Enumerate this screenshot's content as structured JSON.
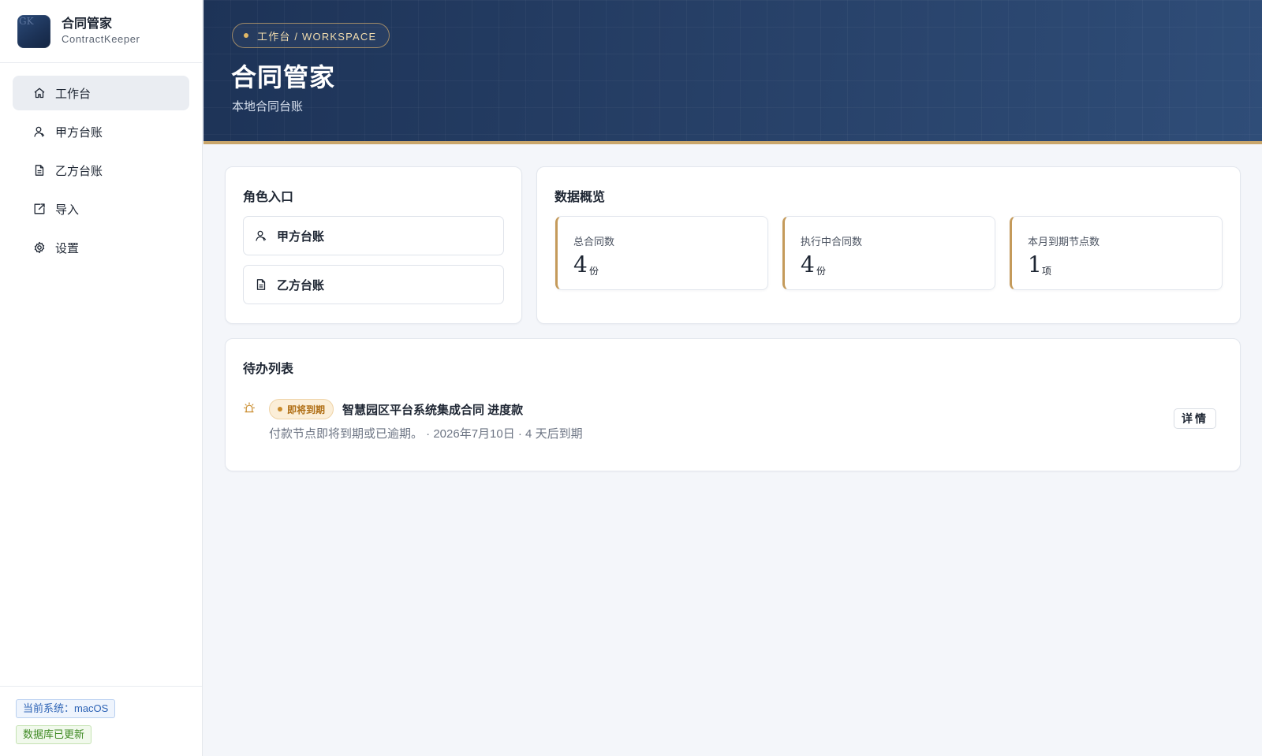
{
  "app": {
    "logo_text": "GK",
    "title": "合同管家",
    "subtitle": "ContractKeeper"
  },
  "nav": {
    "items": [
      {
        "label": "工作台",
        "icon": "home-icon",
        "active": true
      },
      {
        "label": "甲方台账",
        "icon": "user-icon"
      },
      {
        "label": "乙方台账",
        "icon": "document-icon"
      },
      {
        "label": "导入",
        "icon": "import-icon"
      },
      {
        "label": "设置",
        "icon": "gear-icon"
      }
    ]
  },
  "footer": {
    "system_tag": "当前系统：macOS",
    "db_tag": "数据库已更新"
  },
  "header": {
    "breadcrumb": "工作台 / WORKSPACE",
    "title": "合同管家",
    "subtitle": "本地合同台账"
  },
  "roles": {
    "title": "角色入口",
    "buttons": [
      {
        "label": "甲方台账",
        "icon": "user-icon"
      },
      {
        "label": "乙方台账",
        "icon": "document-icon"
      }
    ]
  },
  "overview": {
    "title": "数据概览",
    "stats": [
      {
        "label": "总合同数",
        "value": "4",
        "unit": "份"
      },
      {
        "label": "执行中合同数",
        "value": "4",
        "unit": "份"
      },
      {
        "label": "本月到期节点数",
        "value": "1",
        "unit": "项"
      }
    ]
  },
  "todo": {
    "title": "待办列表",
    "items": [
      {
        "icon": "alarm-icon",
        "badge": "即将到期",
        "title": "智慧园区平台系统集成合同 进度款",
        "desc": "付款节点即将到期或已逾期。 · 2026年7月10日 · 4 天后到期",
        "action": "详情"
      }
    ]
  },
  "colors": {
    "accent_gold": "#c9a66b",
    "header_navy": "#263f66",
    "badge_orange": "#b06f16"
  }
}
